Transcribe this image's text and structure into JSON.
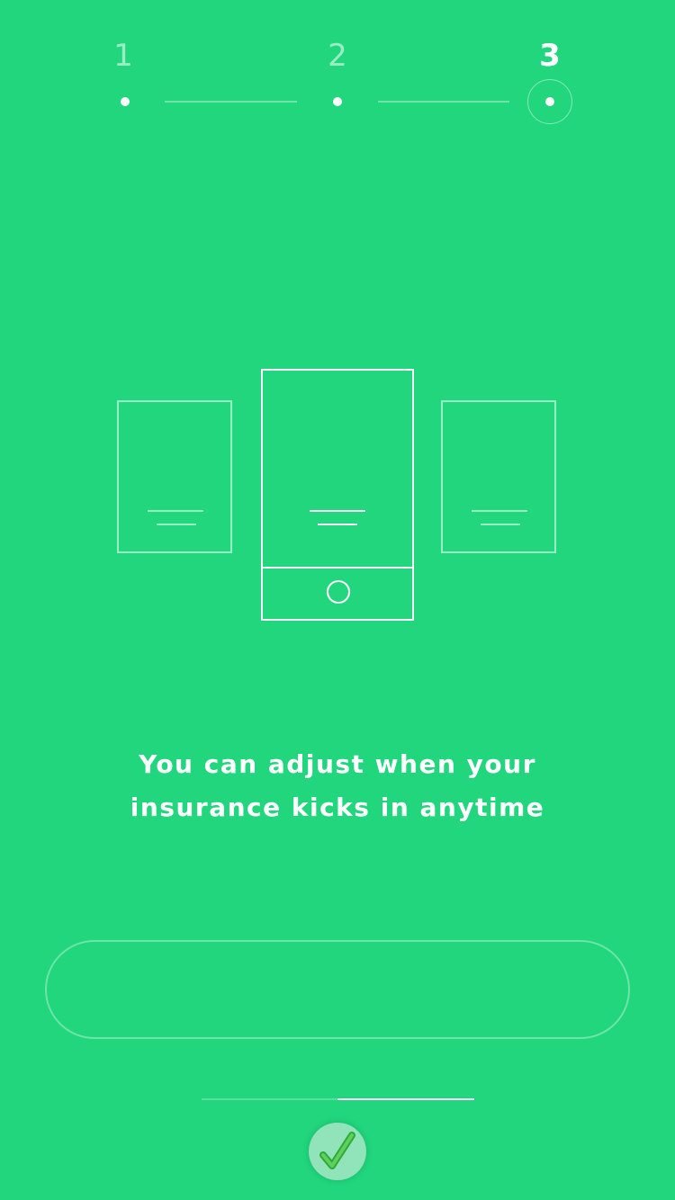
{
  "stepper": {
    "steps": [
      {
        "label": "1",
        "state": "done"
      },
      {
        "label": "2",
        "state": "done"
      },
      {
        "label": "3",
        "state": "current"
      }
    ]
  },
  "illustration": {
    "icon": "phone-cards-illustration"
  },
  "message": {
    "line1": "You can adjust when your",
    "line2": "insurance kicks in anytime"
  },
  "cta": {
    "label": ""
  },
  "pager": {
    "current": 2,
    "total": 2
  },
  "colors": {
    "background": "#21d67d",
    "foreground": "#ffffff"
  }
}
